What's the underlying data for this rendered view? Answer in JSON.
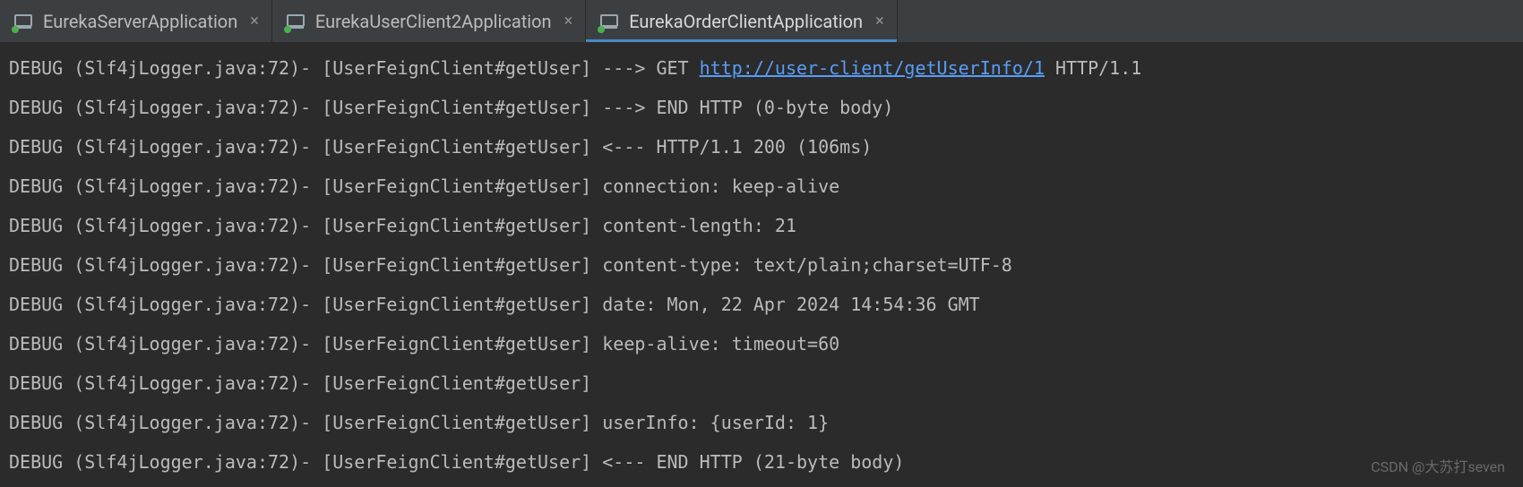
{
  "tabs": [
    {
      "label": "EurekaServerApplication",
      "active": false
    },
    {
      "label": "EurekaUserClient2Application",
      "active": false
    },
    {
      "label": "EurekaOrderClientApplication",
      "active": true
    }
  ],
  "log": {
    "prefix": "DEBUG (Slf4jLogger.java:72)- [UserFeignClient#getUser]",
    "lines": [
      {
        "msg_before_link": "---> GET ",
        "link": "http://user-client/getUserInfo/1",
        "msg_after_link": " HTTP/1.1"
      },
      {
        "msg": "---> END HTTP (0-byte body)"
      },
      {
        "msg": "<--- HTTP/1.1 200 (106ms)"
      },
      {
        "msg": "connection: keep-alive"
      },
      {
        "msg": "content-length: 21"
      },
      {
        "msg": "content-type: text/plain;charset=UTF-8"
      },
      {
        "msg": "date: Mon, 22 Apr 2024 14:54:36 GMT"
      },
      {
        "msg": "keep-alive: timeout=60"
      },
      {
        "msg": ""
      },
      {
        "msg": "userInfo: {userId: 1}"
      },
      {
        "msg": "<--- END HTTP (21-byte body)"
      }
    ]
  },
  "watermark": "CSDN @大苏打seven"
}
